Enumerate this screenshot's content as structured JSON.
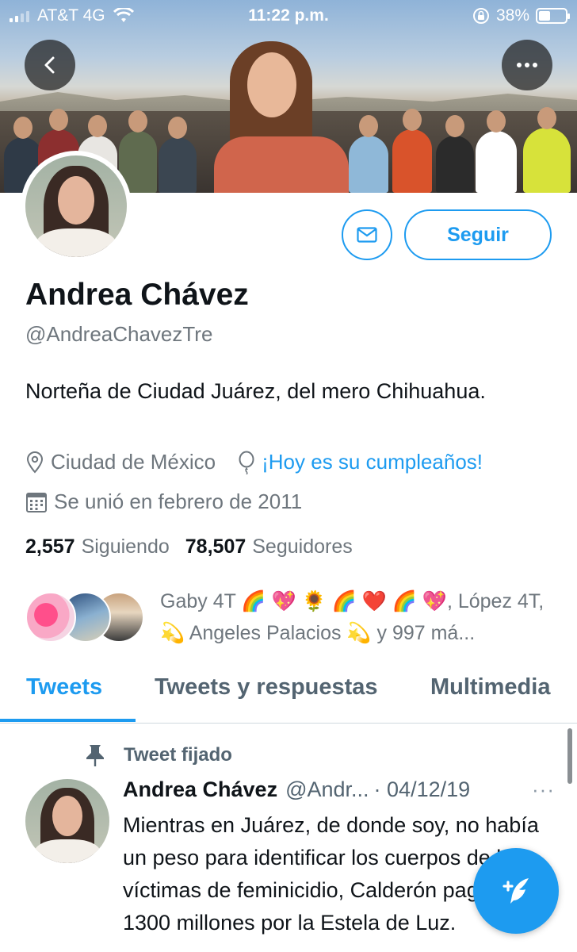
{
  "status_bar": {
    "carrier": "AT&T 4G",
    "time": "11:22 p.m.",
    "battery": "38%",
    "battery_level": 0.38
  },
  "profile": {
    "name": "Andrea Chávez",
    "handle": "@AndreaChavezTre",
    "bio": "Norteña de Ciudad Juárez, del mero Chihuahua.",
    "location": "Ciudad de México",
    "birthday": "¡Hoy es su cumpleaños!",
    "joined": "Se unió en febrero de 2011",
    "following_count": "2,557",
    "following_label": "Siguiendo",
    "followers_count": "78,507",
    "followers_label": "Seguidores",
    "follow_button": "Seguir",
    "known_followers": "Gaby 4T 🌈 💖 🌻 🌈 ❤️ 🌈 💖, López 4T, 💫 Angeles Palacios 💫 y 997 má..."
  },
  "tabs": [
    {
      "label": "Tweets",
      "active": true
    },
    {
      "label": "Tweets y respuestas",
      "active": false
    },
    {
      "label": "Multimedia",
      "active": false
    }
  ],
  "pinned_tweet": {
    "pinned_label": "Tweet fijado",
    "author": "Andrea Chávez",
    "handle": "@Andr...",
    "date": "· 04/12/19",
    "more": "···",
    "text": "Mientras en Juárez, de donde soy, no había un peso para identificar los cuerpos de las víctimas de feminicidio, Calderón pagaba 1300 millones por la Estela de Luz."
  },
  "colors": {
    "accent": "#1d9bf0",
    "secondary_text": "#6e767d",
    "primary_text": "#0f1419"
  },
  "icons": [
    "back-icon",
    "more-icon",
    "mail-icon",
    "location-icon",
    "balloon-icon",
    "calendar-icon",
    "pin-icon",
    "compose-icon",
    "wifi-icon",
    "lock-rotation-icon"
  ]
}
